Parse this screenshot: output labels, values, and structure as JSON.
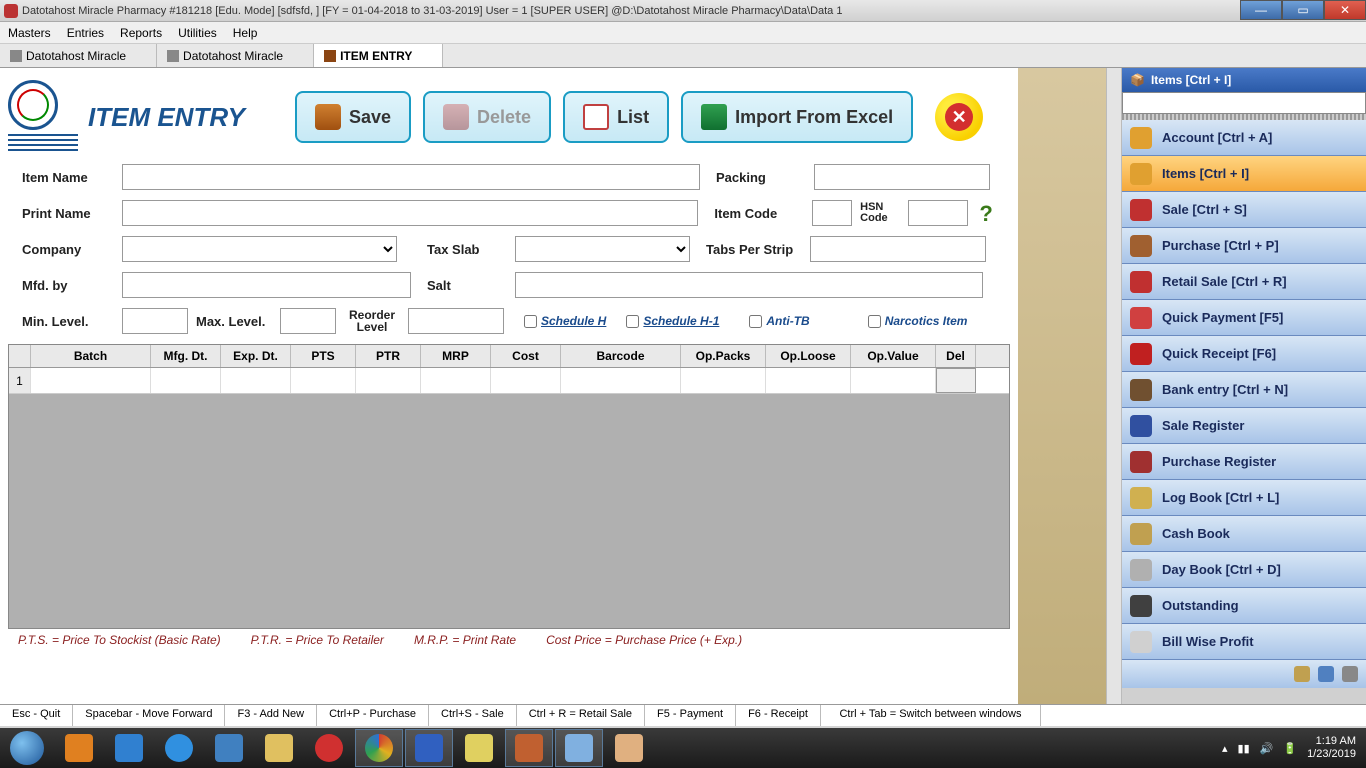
{
  "window": {
    "title": "Datotahost Miracle Pharmacy #181218  [Edu. Mode]  [sdfsfd, ] [FY = 01-04-2018 to 31-03-2019] User = 1 [SUPER USER]  @D:\\Datotahost Miracle Pharmacy\\Data\\Data 1"
  },
  "menu": [
    "Masters",
    "Entries",
    "Reports",
    "Utilities",
    "Help"
  ],
  "tabs": [
    {
      "label": "Datotahost Miracle",
      "active": false
    },
    {
      "label": "Datotahost Miracle",
      "active": false
    },
    {
      "label": "ITEM ENTRY",
      "active": true
    }
  ],
  "page": {
    "title": "ITEM ENTRY"
  },
  "toolbar": {
    "save": "Save",
    "delete": "Delete",
    "list": "List",
    "import": "Import From Excel"
  },
  "form": {
    "labels": {
      "itemName": "Item Name",
      "printName": "Print Name",
      "company": "Company",
      "mfdBy": "Mfd. by",
      "minLevel": "Min. Level.",
      "maxLevel": "Max. Level.",
      "reorder": "Reorder Level",
      "packing": "Packing",
      "itemCode": "Item Code",
      "hsn": "HSN Code",
      "taxSlab": "Tax Slab",
      "tabsPerStrip": "Tabs Per Strip",
      "salt": "Salt"
    },
    "checks": {
      "schH": "Schedule H",
      "schH1": "Schedule H-1",
      "antiTB": "Anti-TB",
      "narcotics": "Narcotics Item"
    },
    "values": {
      "itemName": "",
      "printName": "",
      "company": "",
      "mfdBy": "",
      "minLevel": "",
      "maxLevel": "",
      "reorder": "",
      "packing": "",
      "itemCode": "",
      "hsn": "",
      "taxSlab": "",
      "tabsPerStrip": "",
      "salt": ""
    }
  },
  "grid": {
    "headers": [
      "Batch",
      "Mfg. Dt.",
      "Exp. Dt.",
      "PTS",
      "PTR",
      "MRP",
      "Cost",
      "Barcode",
      "Op.Packs",
      "Op.Loose",
      "Op.Value",
      "Del"
    ],
    "rows": [
      {
        "num": "1"
      }
    ]
  },
  "footnote": {
    "pts": "P.T.S. = Price To Stockist (Basic Rate)",
    "ptr": "P.T.R. = Price To Retailer",
    "mrp": "M.R.P.  = Print Rate",
    "cost": "Cost Price =  Purchase Price (+ Exp.)"
  },
  "shortcuts": [
    "Esc - Quit",
    "Spacebar - Move Forward",
    "F3 - Add New",
    "Ctrl+P - Purchase",
    "Ctrl+S - Sale",
    "Ctrl + R = Retail Sale",
    "F5 - Payment",
    "F6 - Receipt",
    "Ctrl + Tab = Switch between windows"
  ],
  "sidepanel": {
    "header": "Items [Ctrl + I]",
    "items": [
      {
        "label": "Account [Ctrl + A]",
        "color": "#e0a030"
      },
      {
        "label": "Items [Ctrl + I]",
        "color": "#e0a030",
        "active": true
      },
      {
        "label": "Sale [Ctrl + S]",
        "color": "#c03030"
      },
      {
        "label": "Purchase [Ctrl + P]",
        "color": "#a06030"
      },
      {
        "label": "Retail Sale [Ctrl + R]",
        "color": "#c03030"
      },
      {
        "label": "Quick Payment [F5]",
        "color": "#d04040"
      },
      {
        "label": "Quick Receipt [F6]",
        "color": "#c02020"
      },
      {
        "label": "Bank entry [Ctrl + N]",
        "color": "#705030"
      },
      {
        "label": "Sale Register",
        "color": "#3050a0"
      },
      {
        "label": "Purchase Register",
        "color": "#a03030"
      },
      {
        "label": "Log Book [Ctrl + L]",
        "color": "#d0b050"
      },
      {
        "label": "Cash Book",
        "color": "#c0a050"
      },
      {
        "label": "Day Book [Ctrl + D]",
        "color": "#b0b0b0"
      },
      {
        "label": "Outstanding",
        "color": "#404040"
      },
      {
        "label": "Bill Wise Profit",
        "color": "#d0d0d0"
      }
    ]
  },
  "tray": {
    "time": "1:19 AM",
    "date": "1/23/2019"
  }
}
